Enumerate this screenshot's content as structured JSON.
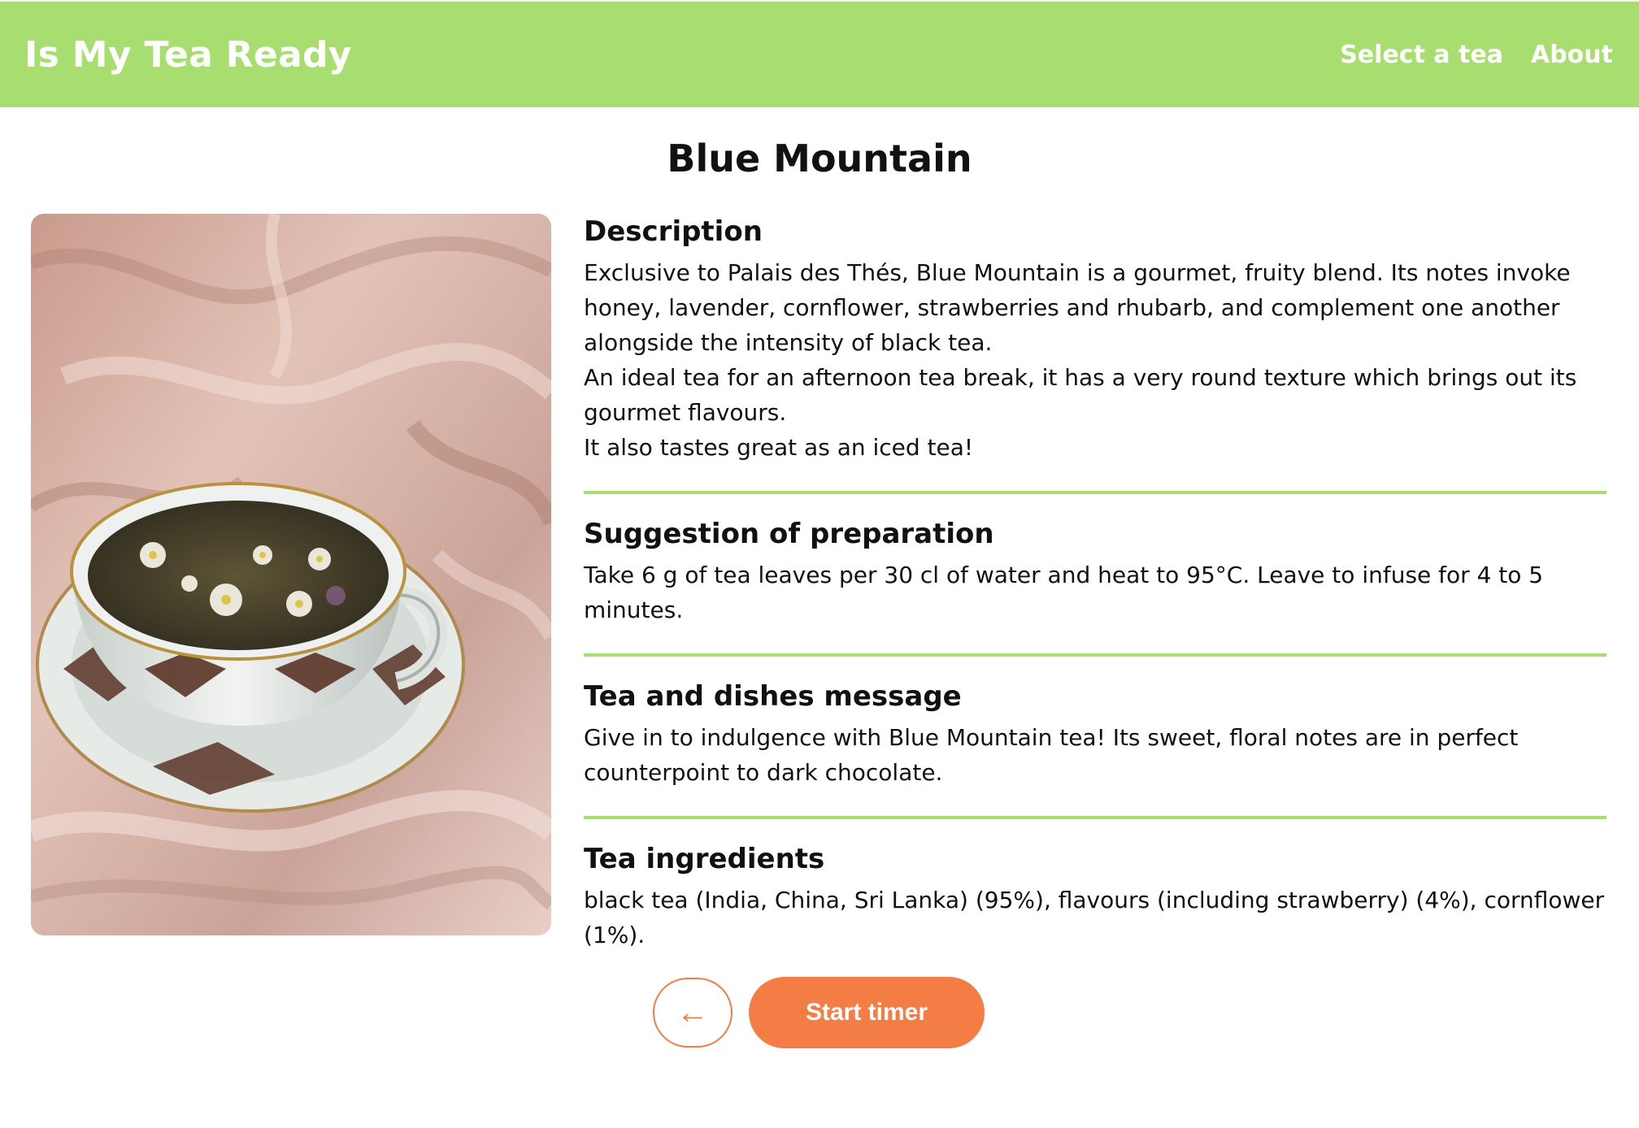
{
  "header": {
    "brand": "Is My Tea Ready",
    "nav": [
      {
        "label": "Select a tea"
      },
      {
        "label": "About"
      }
    ],
    "background_color": "#a8de70"
  },
  "tea": {
    "name": "Blue Mountain",
    "sections": [
      {
        "heading": "Description",
        "lines": [
          "Exclusive to Palais des Thés, Blue Mountain is a gourmet, fruity blend. Its notes invoke honey, lavender, cornflower, strawberries and rhubarb, and complement one another alongside the intensity of black tea.",
          "An ideal tea for an afternoon tea break, it has a very round texture which brings out its gourmet flavours.",
          "It also tastes great as an iced tea!"
        ]
      },
      {
        "heading": "Suggestion of preparation",
        "lines": [
          "Take 6 g of tea leaves per 30 cl of water and heat to 95°C. Leave to infuse for 4 to 5 minutes."
        ]
      },
      {
        "heading": "Tea and dishes message",
        "lines": [
          "Give in to indulgence with Blue Mountain tea! Its sweet, floral notes are in perfect counterpoint to dark chocolate."
        ]
      },
      {
        "heading": "Tea ingredients",
        "lines": [
          "black tea (India, China, Sri Lanka) (95%), flavours (including strawberry) (4%), cornflower (1%)."
        ]
      }
    ]
  },
  "actions": {
    "back_glyph": "←",
    "start_label": "Start timer",
    "accent_color": "#f47c45"
  },
  "icons": {
    "back": "arrow-left-icon",
    "photo": "tea-cup-photo"
  }
}
